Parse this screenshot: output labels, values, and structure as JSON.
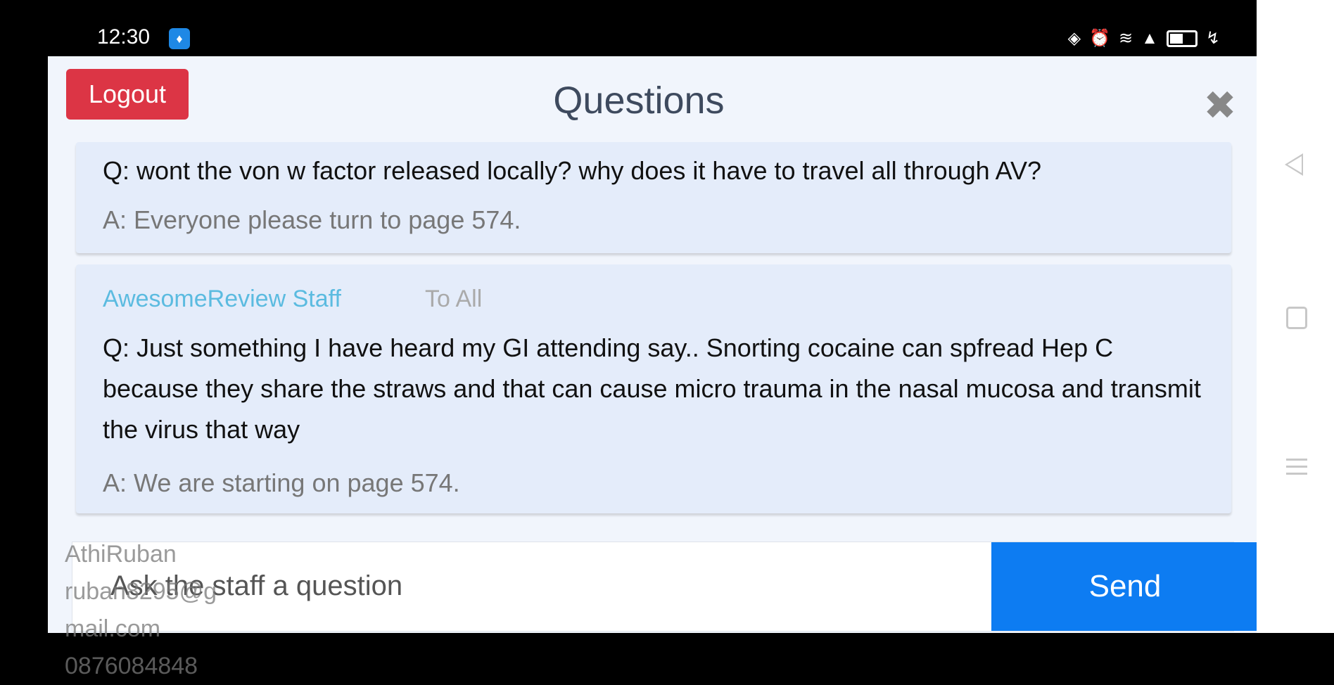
{
  "status_bar": {
    "time": "12:30",
    "icons": [
      "app-notification-icon",
      "data-saver-icon",
      "alarm-icon",
      "wifi-icon",
      "signal-icon",
      "battery-charging-icon"
    ]
  },
  "header": {
    "logout_label": "Logout",
    "title": "Questions",
    "close_icon": "close-icon"
  },
  "questions": [
    {
      "question": "Q: wont the von w factor released locally? why does it have to travel all through AV?",
      "answer": "A: Everyone please turn to page 574."
    },
    {
      "author": "AwesomeReview Staff",
      "recipient": "To All",
      "question": "Q: Just something I have heard my GI attending say.. Snorting cocaine can spfread Hep C because they share the straws and that can cause micro trauma in the nasal mucosa and transmit the virus that way",
      "answer": "A: We are starting on page 574."
    }
  ],
  "composer": {
    "placeholder": "Ask the staff a question",
    "send_label": "Send"
  },
  "watermark": {
    "name": "AthiRuban",
    "email_line1": "ruban8295@g",
    "email_line2": "mail.com",
    "phone": "0876084848"
  },
  "nav_bar": {
    "icons": [
      "back-icon",
      "home-icon",
      "menu-icon"
    ]
  },
  "colors": {
    "logout": "#dc3545",
    "send": "#0d7cf2",
    "author": "#5bbbe0",
    "card": "#e4ecfa"
  }
}
